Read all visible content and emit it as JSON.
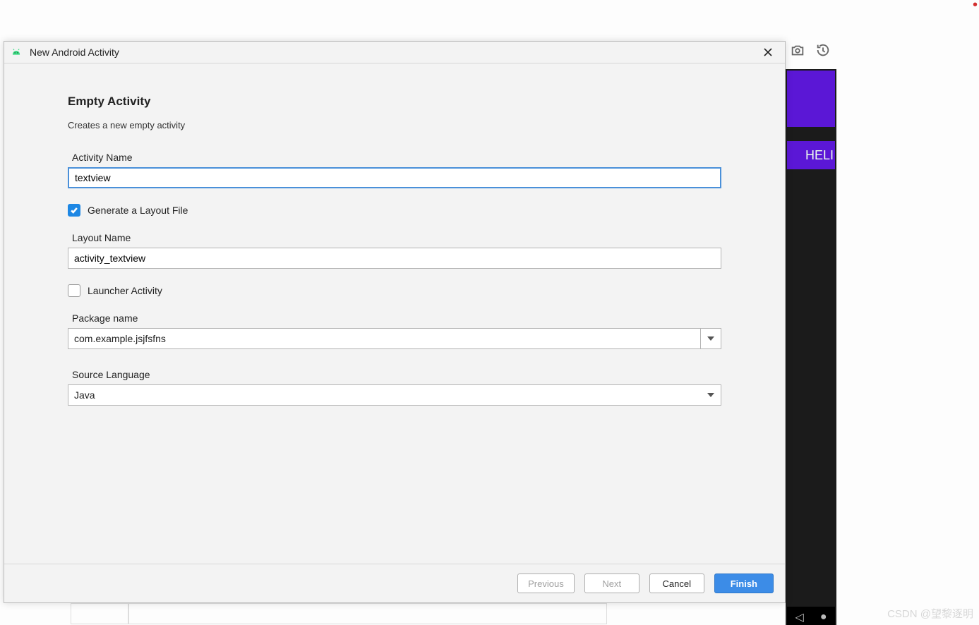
{
  "dialog": {
    "title": "New Android Activity",
    "heading": "Empty Activity",
    "subtitle": "Creates a new empty activity",
    "fields": {
      "activity_name": {
        "label": "Activity Name",
        "value": "textview"
      },
      "generate_layout": {
        "label": "Generate a Layout File",
        "checked": true
      },
      "layout_name": {
        "label": "Layout Name",
        "value": "activity_textview"
      },
      "launcher": {
        "label": "Launcher Activity",
        "checked": false
      },
      "package_name": {
        "label": "Package name",
        "value": "com.example.jsjfsfns"
      },
      "source_language": {
        "label": "Source Language",
        "value": "Java"
      }
    },
    "buttons": {
      "previous": "Previous",
      "next": "Next",
      "cancel": "Cancel",
      "finish": "Finish"
    }
  },
  "bg": {
    "preview_text": "HELI"
  },
  "watermark": "CSDN @望黎逐明"
}
